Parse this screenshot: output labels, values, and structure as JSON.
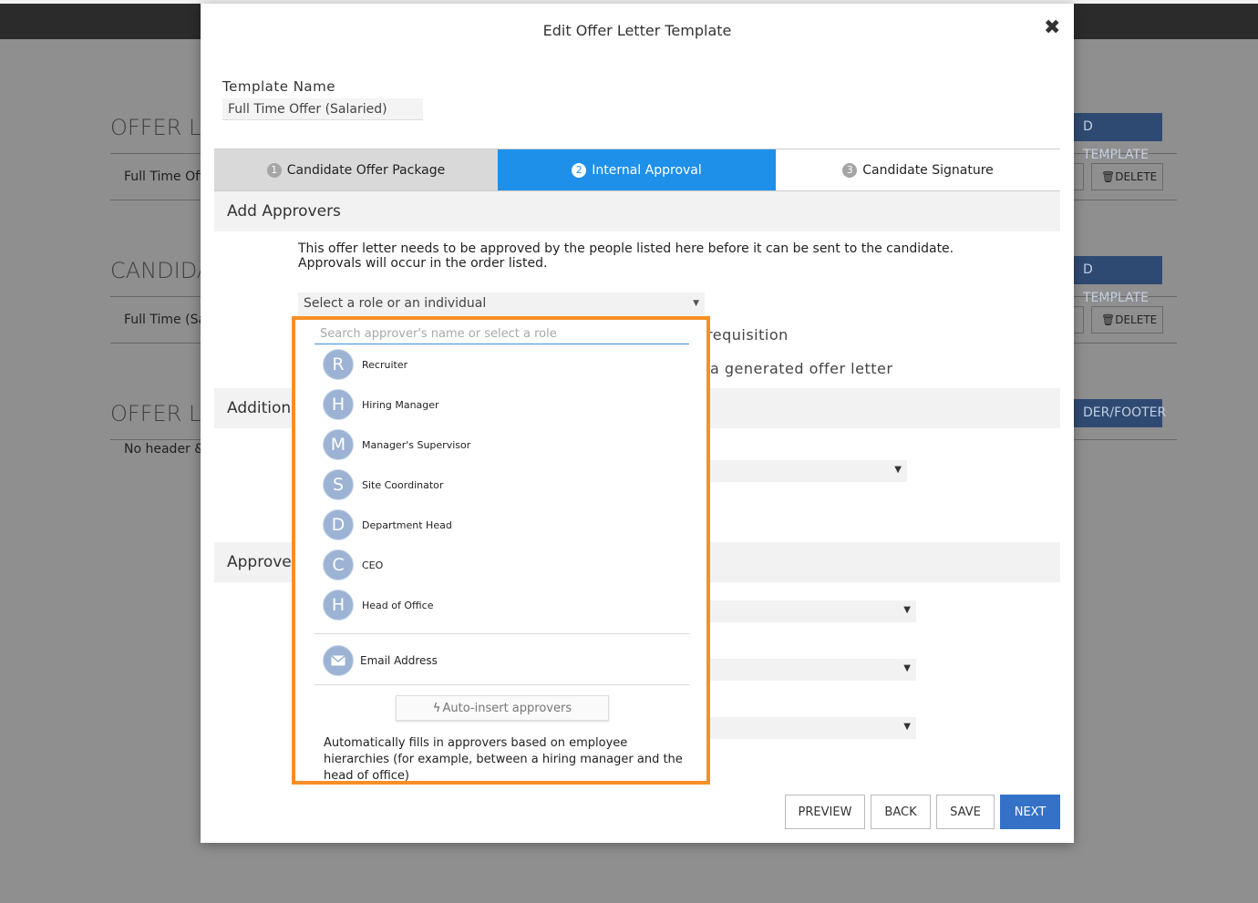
{
  "background": {
    "sections": [
      {
        "title": "OFFER LE",
        "row": "Full Time Off",
        "action": "D TEMPLATE",
        "delete": "DELETE"
      },
      {
        "title": "CANDIDA",
        "row": "Full Time (Sal",
        "action": "D TEMPLATE",
        "delete": "DELETE"
      },
      {
        "title": "OFFER LE",
        "row": "No header &",
        "action": "DER/FOOTER"
      }
    ]
  },
  "modal": {
    "title": "Edit Offer Letter Template",
    "close_icon": "close-icon",
    "template_name_label": "Template Name",
    "template_name_value": "Full Time Offer (Salaried)",
    "steps": [
      {
        "num": "1",
        "label": "Candidate Offer Package"
      },
      {
        "num": "2",
        "label": "Internal Approval",
        "active": true
      },
      {
        "num": "3",
        "label": "Candidate Signature"
      }
    ],
    "add_approvers_heading": "Add Approvers",
    "description": "This offer letter needs to be approved by the people listed here before it can be sent to the candidate. Approvals will occur in the order listed.",
    "select_placeholder": "Select a role or an individual",
    "partial_requisition": "requisition",
    "partial_generated": "a generated offer letter",
    "additional_heading": "Additional",
    "approvers_heading": "Approver",
    "buttons": {
      "preview": "PREVIEW",
      "back": "BACK",
      "save": "SAVE",
      "next": "NEXT"
    }
  },
  "dropdown": {
    "search_placeholder": "Search approver's name or select a role",
    "roles": [
      {
        "initial": "R",
        "label": "Recruiter"
      },
      {
        "initial": "H",
        "label": "Hiring Manager"
      },
      {
        "initial": "M",
        "label": "Manager's Supervisor"
      },
      {
        "initial": "S",
        "label": "Site Coordinator"
      },
      {
        "initial": "D",
        "label": "Department Head"
      },
      {
        "initial": "C",
        "label": "CEO"
      },
      {
        "initial": "H",
        "label": "Head of Office"
      }
    ],
    "email_label": "Email Address",
    "email_icon": "envelope-icon",
    "auto_insert_label": "Auto-insert approvers",
    "auto_insert_icon": "lightning-icon",
    "auto_insert_description": "Automatically fills in approvers based on employee hierarchies (for example, between a hiring manager and the head of office)",
    "highlight_color": "#f88f26",
    "accent_color": "#1e90ea"
  }
}
